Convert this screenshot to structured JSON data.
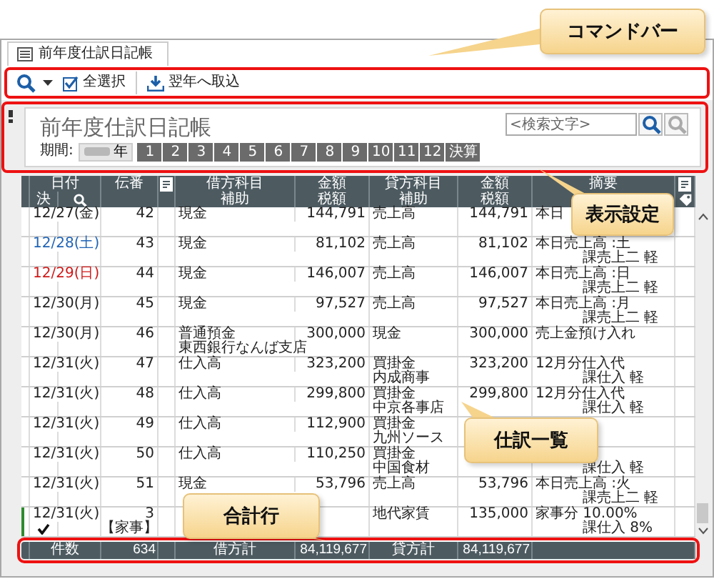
{
  "window": {
    "tab": "前年度仕訳日記帳"
  },
  "command_bar": {
    "highlighted": true,
    "items": [
      {
        "kind": "select_all",
        "label": "全選択"
      },
      {
        "kind": "import",
        "label": "翌年へ取込"
      }
    ]
  },
  "header": {
    "highlighted": true,
    "title": "前年度仕訳日記帳",
    "search": {
      "placeholder": "<検索文字>"
    },
    "period_label": "期間:",
    "year": "年",
    "periods": [
      "1",
      "2",
      "3",
      "4",
      "5",
      "6",
      "7",
      "8",
      "9",
      "10",
      "11",
      "12",
      "決算"
    ]
  },
  "table": {
    "columns": [
      {
        "label": "日付"
      },
      {
        "label": "伝番"
      },
      {
        "label": "借方科目"
      },
      {
        "label": "金額"
      },
      {
        "label": "貸方科目"
      },
      {
        "label": "金額"
      },
      {
        "label": "摘要"
      }
    ],
    "subcolumns": [
      {
        "label": "決"
      },
      {
        "label": "補助"
      },
      {
        "label": "税額"
      },
      {
        "label": "補助"
      },
      {
        "label": "税額"
      }
    ],
    "rows": [
      {
        "date": "12/27(金)",
        "color": "#222222",
        "number": "42",
        "debit": "現金",
        "debit_amount": "144,791",
        "credit": "売上高",
        "credit_amount": "144,791",
        "memo": "本日",
        "checked": false,
        "selected": false
      },
      {
        "date": "12/28(土)",
        "color": "#1f63b5",
        "number": "43",
        "debit": "現金",
        "debit_amount": "81,102",
        "credit": "売上高",
        "credit_amount": "81,102",
        "memo": "本日売上高 :土",
        "tax_class": "課売上二 軽",
        "checked": false,
        "selected": false
      },
      {
        "date": "12/29(日)",
        "color": "#d01818",
        "number": "44",
        "debit": "現金",
        "debit_amount": "146,007",
        "credit": "売上高",
        "credit_amount": "146,007",
        "memo": "本日売上高 :日",
        "tax_class": "課売上二 軽",
        "checked": false,
        "selected": false
      },
      {
        "date": "12/30(月)",
        "color": "#222222",
        "number": "45",
        "debit": "現金",
        "debit_amount": "97,527",
        "credit": "売上高",
        "credit_amount": "97,527",
        "memo": "本日売上高 :月",
        "tax_class": "課売上二 軽",
        "checked": false,
        "selected": false
      },
      {
        "date": "12/30(月)",
        "color": "#222222",
        "number": "46",
        "debit": "普通預金",
        "debit_sub": "東西銀行なんば支店",
        "debit_amount": "300,000",
        "credit": "現金",
        "credit_amount": "300,000",
        "memo": "売上金預け入れ",
        "checked": false,
        "selected": false
      },
      {
        "date": "12/31(火)",
        "color": "#222222",
        "number": "47",
        "debit": "仕入高",
        "debit_amount": "323,200",
        "credit": "買掛金",
        "credit_sub": "内成商事",
        "credit_amount": "323,200",
        "memo": "12月分仕入代",
        "tax_class": "課仕入 軽",
        "checked": false,
        "selected": false
      },
      {
        "date": "12/31(火)",
        "color": "#222222",
        "number": "48",
        "debit": "仕入高",
        "debit_amount": "299,800",
        "credit": "買掛金",
        "credit_sub": "中京各事店",
        "credit_amount": "299,800",
        "memo": "12月分仕入代",
        "tax_class": "課仕入 軽",
        "checked": false,
        "selected": false
      },
      {
        "date": "12/31(火)",
        "color": "#222222",
        "number": "49",
        "debit": "仕入高",
        "debit_amount": "112,900",
        "credit": "買掛金",
        "credit_sub": "九州ソース",
        "checked": false,
        "selected": false
      },
      {
        "date": "12/31(火)",
        "color": "#222222",
        "number": "50",
        "debit": "仕入高",
        "debit_amount": "110,250",
        "credit": "買掛金",
        "credit_sub": "中国食材",
        "tax_class": "課仕入 軽",
        "checked": false,
        "selected": false
      },
      {
        "date": "12/31(火)",
        "color": "#222222",
        "number": "51",
        "debit": "現金",
        "debit_amount": "53,796",
        "credit": "売上高",
        "credit_amount": "53,796",
        "memo": "本日売上高 :火",
        "tax_class": "課売上二 軽",
        "checked": false,
        "selected": false
      },
      {
        "date": "12/31(火)",
        "color": "#222222",
        "number": "3",
        "voucher_tag": "【家事】",
        "credit": "地代家賃",
        "credit_amount": "135,000",
        "memo": "家事分 10.00%",
        "tax_class": "課仕入 8%",
        "checked": true,
        "selected": true
      }
    ],
    "totals": {
      "highlighted": true,
      "count_label": "件数",
      "count": "634",
      "debit_label": "借方計",
      "debit_total": "84,119,677",
      "credit_label": "貸方計",
      "credit_total": "84,119,677"
    }
  },
  "callouts": [
    {
      "label": "コマンドバー"
    },
    {
      "label": "表示設定"
    },
    {
      "label": "仕訳一覧"
    },
    {
      "label": "合計行"
    }
  ]
}
